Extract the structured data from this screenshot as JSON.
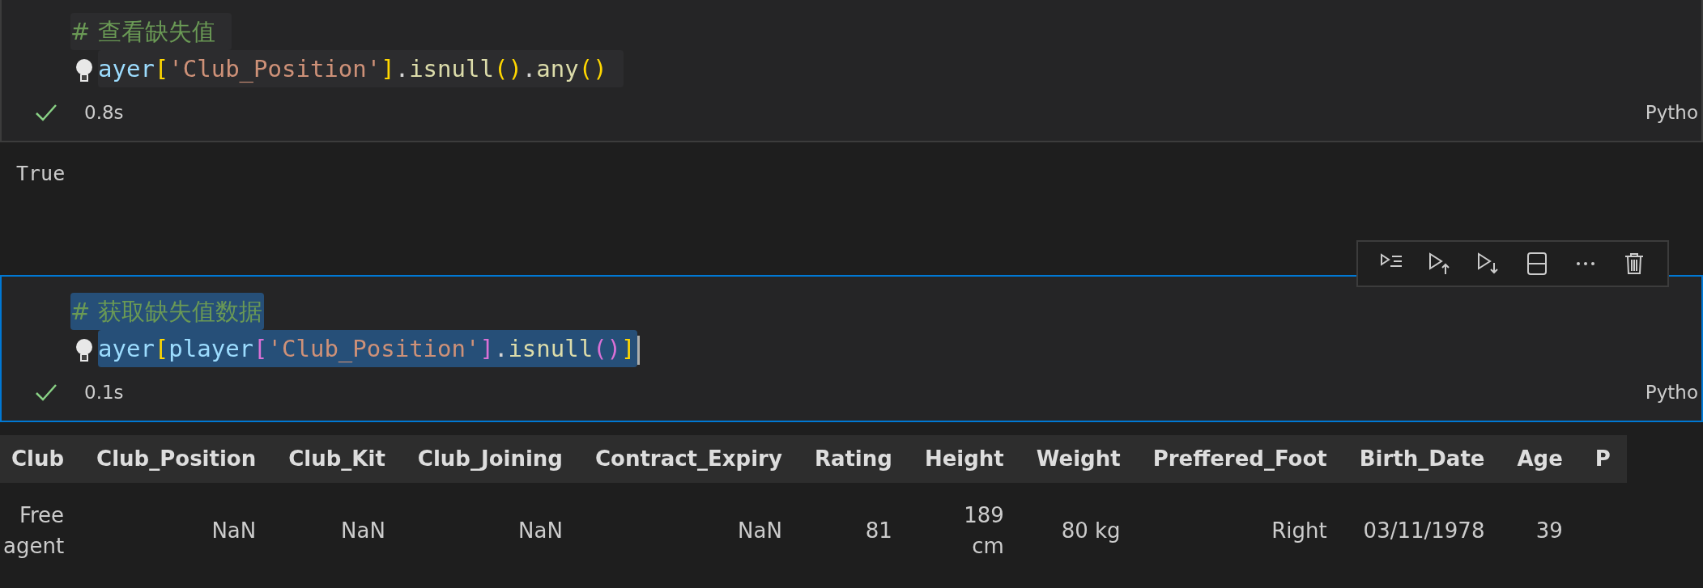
{
  "cells": [
    {
      "focused": false,
      "lines": [
        {
          "selected": false,
          "tokens": [
            {
              "kind": "comment",
              "text": "# 查看缺失值"
            }
          ]
        },
        {
          "selected": false,
          "lightbulb": true,
          "tokens": [
            {
              "kind": "var",
              "text": "ayer"
            },
            {
              "kind": "bracket1",
              "text": "["
            },
            {
              "kind": "string",
              "text": "'Club_Position'"
            },
            {
              "kind": "bracket1",
              "text": "]"
            },
            {
              "kind": "punct",
              "text": "."
            },
            {
              "kind": "func",
              "text": "isnull"
            },
            {
              "kind": "bracket1",
              "text": "()"
            },
            {
              "kind": "punct",
              "text": "."
            },
            {
              "kind": "func",
              "text": "any"
            },
            {
              "kind": "bracket1",
              "text": "()"
            }
          ]
        }
      ],
      "status": {
        "success": true,
        "time": "0.8s",
        "language": "Pytho"
      },
      "output": {
        "kind": "text",
        "text": "True"
      }
    },
    {
      "focused": true,
      "toolbar": [
        {
          "kind": "run-by-line"
        },
        {
          "kind": "run-above"
        },
        {
          "kind": "run-below"
        },
        {
          "kind": "split"
        },
        {
          "kind": "more"
        },
        {
          "kind": "delete"
        }
      ],
      "lines": [
        {
          "selected": true,
          "tokens": [
            {
              "kind": "comment",
              "text": "# 获取缺失值数据"
            }
          ]
        },
        {
          "selected": true,
          "cursor": true,
          "lightbulb": true,
          "tokens": [
            {
              "kind": "var",
              "text": "ayer"
            },
            {
              "kind": "bracket1",
              "text": "["
            },
            {
              "kind": "var",
              "text": "player"
            },
            {
              "kind": "bracket2",
              "text": "["
            },
            {
              "kind": "string",
              "text": "'Club_Position'"
            },
            {
              "kind": "bracket2",
              "text": "]"
            },
            {
              "kind": "punct",
              "text": "."
            },
            {
              "kind": "func",
              "text": "isnull"
            },
            {
              "kind": "bracket2",
              "text": "()"
            },
            {
              "kind": "bracket1",
              "text": "]"
            }
          ]
        }
      ],
      "status": {
        "success": true,
        "time": "0.1s",
        "language": "Pytho"
      },
      "output": {
        "kind": "table",
        "columns": [
          "Club",
          "Club_Position",
          "Club_Kit",
          "Club_Joining",
          "Contract_Expiry",
          "Rating",
          "Height",
          "Weight",
          "Preffered_Foot",
          "Birth_Date",
          "Age",
          "P"
        ],
        "rows": [
          [
            "Free agent",
            "NaN",
            "NaN",
            "NaN",
            "NaN",
            "81",
            "189 cm",
            "80 kg",
            "Right",
            "03/11/1978",
            "39",
            ""
          ]
        ]
      }
    }
  ]
}
